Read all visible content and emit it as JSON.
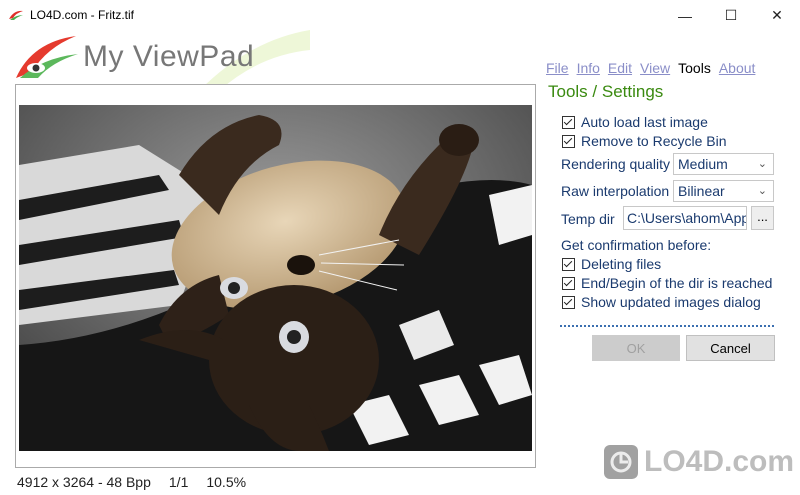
{
  "window": {
    "title": "LO4D.com - Fritz.tif",
    "minimize_glyph": "—",
    "maximize_glyph": "☐",
    "close_glyph": "✕"
  },
  "app": {
    "name": "My ViewPad"
  },
  "menu": {
    "items": [
      {
        "label": "File",
        "active": false
      },
      {
        "label": "Info",
        "active": false
      },
      {
        "label": "Edit",
        "active": false
      },
      {
        "label": "View",
        "active": false
      },
      {
        "label": "Tools",
        "active": true
      },
      {
        "label": "About",
        "active": false
      }
    ]
  },
  "status": {
    "dimensions": "4912 x 3264 - 48 Bpp",
    "page": "1/1",
    "zoom": "10.5%"
  },
  "settings": {
    "title": "Tools / Settings",
    "auto_load": {
      "label": "Auto load last image",
      "checked": true
    },
    "recycle": {
      "label": "Remove to Recycle Bin",
      "checked": true
    },
    "rendering": {
      "label": "Rendering quality",
      "value": "Medium"
    },
    "interpolation": {
      "label": "Raw interpolation",
      "value": "Bilinear"
    },
    "temp_dir": {
      "label": "Temp dir",
      "value": "C:\\Users\\ahom\\App",
      "browse": "..."
    },
    "confirm_heading": "Get confirmation before:",
    "confirm_deleting": {
      "label": "Deleting files",
      "checked": true
    },
    "confirm_end": {
      "label": "End/Begin of the dir is reached",
      "checked": true
    },
    "confirm_updated": {
      "label": "Show updated images dialog",
      "checked": true
    },
    "ok_label": "OK",
    "cancel_label": "Cancel"
  },
  "watermark": {
    "text": "LO4D.com"
  }
}
